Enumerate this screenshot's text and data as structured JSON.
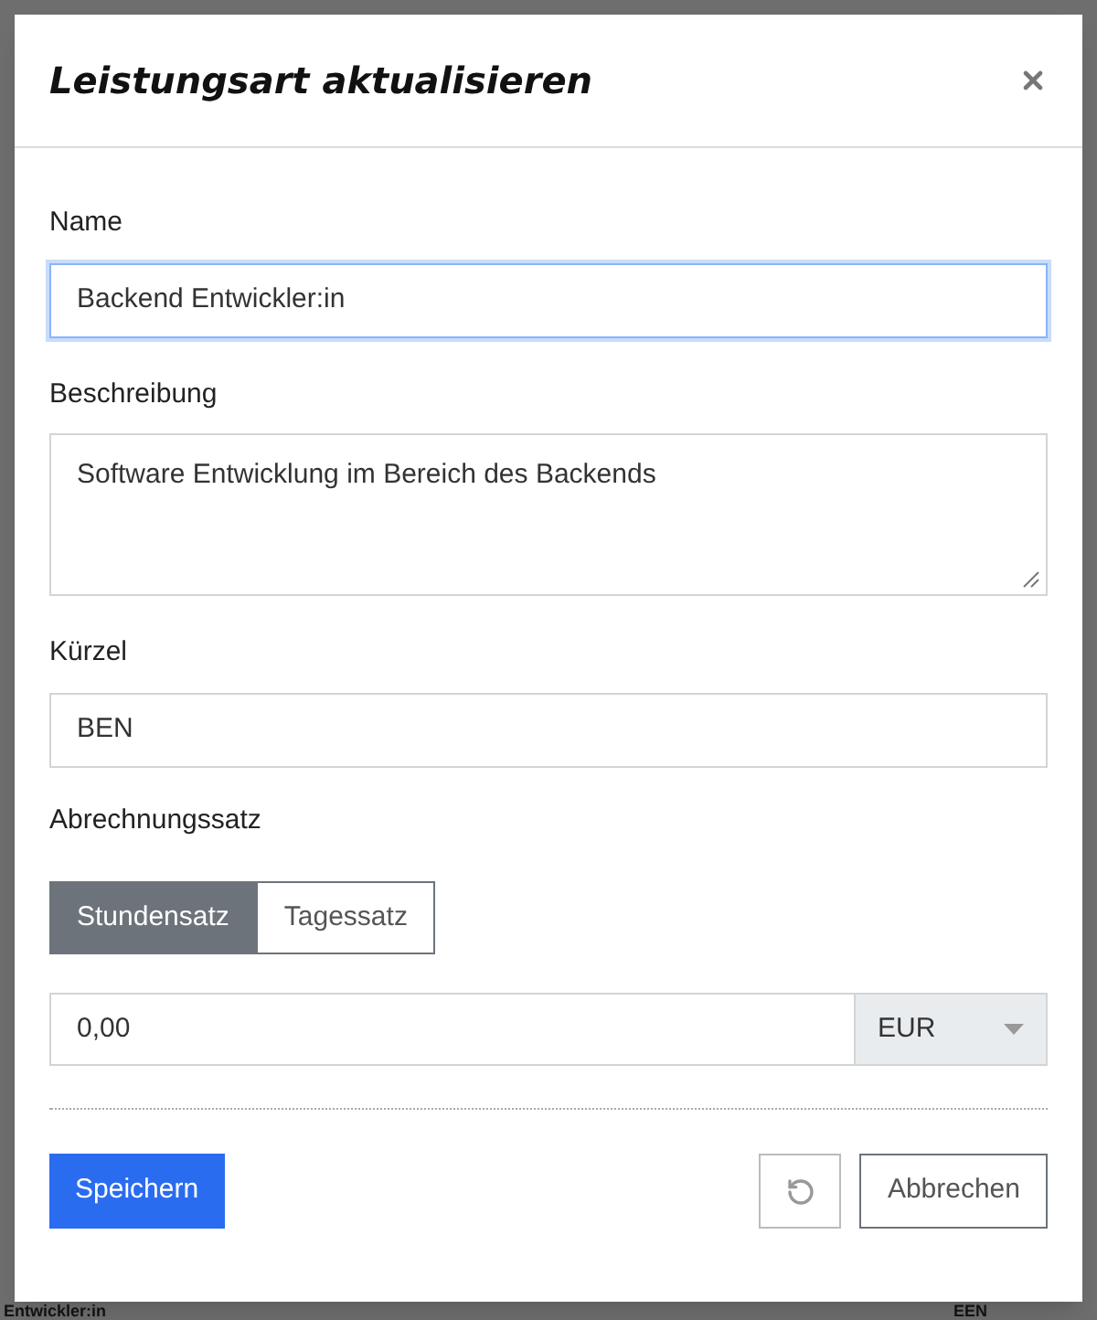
{
  "background": {
    "row_texts": [
      "Entwickler:in",
      "EEN"
    ]
  },
  "dialog": {
    "title": "Leistungsart aktualisieren",
    "fields": [
      {
        "kind": "input",
        "label": "Name",
        "value": "Backend Entwickler:in",
        "focused": true
      },
      {
        "kind": "textarea",
        "label": "Beschreibung",
        "value": "Software Entwicklung im Bereich des Backends",
        "focused": false
      },
      {
        "kind": "input",
        "label": "Kürzel",
        "value": "BEN",
        "focused": false
      }
    ],
    "rate": {
      "label": "Abrechnungssatz",
      "options": [
        {
          "label": "Stundensatz",
          "selected": true
        },
        {
          "label": "Tagessatz",
          "selected": false
        }
      ],
      "amount": "0,00",
      "currency": "EUR"
    },
    "buttons": {
      "save": "Speichern",
      "cancel": "Abbrechen"
    }
  }
}
